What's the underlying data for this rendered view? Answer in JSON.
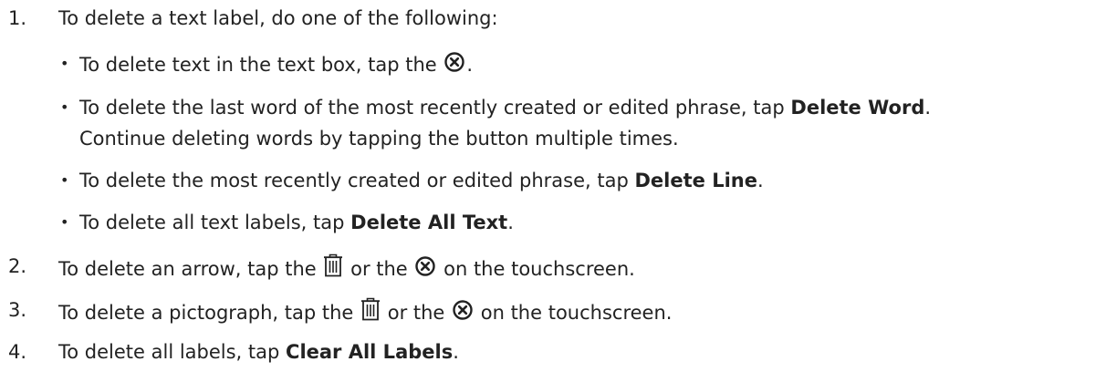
{
  "steps": [
    {
      "number": "1.",
      "text": "To delete a text label, do one of the following:"
    },
    {
      "number": "2.",
      "pre": "To delete an arrow, tap the",
      "mid": "or the",
      "post": "on the touchscreen."
    },
    {
      "number": "3.",
      "pre": "To delete a pictograph, tap the",
      "mid": "or the",
      "post": "on the touchscreen."
    },
    {
      "number": "4.",
      "pre": "To delete all labels, tap",
      "bold": "Clear All Labels",
      "post": "."
    }
  ],
  "bullets": [
    {
      "pre": "To delete text in the text box, tap the",
      "post": "."
    },
    {
      "pre": "To delete the last word of the most recently created or edited phrase, tap",
      "bold": "Delete Word",
      "post": ".",
      "continuation": "Continue deleting words by tapping the button multiple times."
    },
    {
      "pre": "To delete the most recently created or edited phrase, tap",
      "bold": "Delete Line",
      "post": "."
    },
    {
      "pre": "To delete all text labels, tap",
      "bold": "Delete All Text",
      "post": "."
    }
  ],
  "bullet_glyph": "•",
  "icons": {
    "clear": "circle-x-icon",
    "delete": "trash-icon"
  },
  "colors": {
    "text": "#222222",
    "background": "#ffffff"
  }
}
